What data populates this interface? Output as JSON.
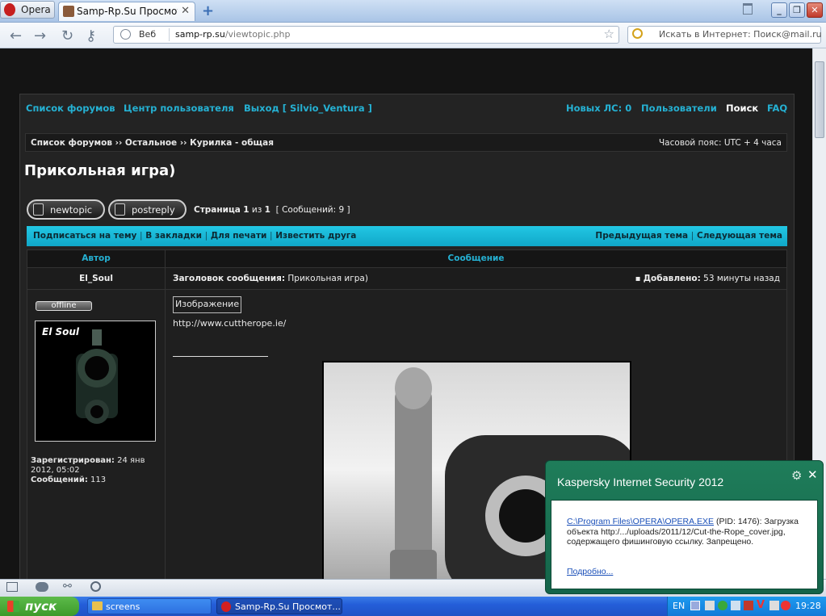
{
  "browser": {
    "menu_label": "Opera",
    "tab_title": "Samp-Rp.Su Просмотр т...",
    "tab_close": "✕",
    "new_tab": "+",
    "address_prefix": "Веб",
    "url_domain": "samp-rp.su",
    "url_path": "/viewtopic.php",
    "search_placeholder": "Искать в Интернет: Поиск@mail.ru"
  },
  "nav": {
    "forum_list": "Список форумов",
    "user_center": "Центр пользователя",
    "logout": "Выход [ Silvio_Ventura ]",
    "new_pm": "Новых ЛС: 0",
    "users": "Пользователи",
    "search": "Поиск",
    "faq": "FAQ"
  },
  "breadcrumb": {
    "path": "Список форумов ›› Остальное ›› Курилка - общая",
    "timezone": "Часовой пояс: UTC + 4 часа"
  },
  "topic": {
    "title": "Прикольная игра)",
    "newtopic_label": "newtopic",
    "postreply_label": "postreply",
    "page_prefix": "Страница",
    "page_current": "1",
    "page_of": "из",
    "page_total": "1",
    "messages": "[ Сообщений: 9 ]"
  },
  "actions": {
    "subscribe": "Подписаться на тему",
    "bookmark": "В закладки",
    "print": "Для печати",
    "notify": "Известить друга",
    "prev_topic": "Предыдущая тема",
    "next_topic": "Следующая тема"
  },
  "table": {
    "col_author": "Автор",
    "col_message": "Сообщение"
  },
  "post": {
    "author": "El_Soul",
    "subject_label": "Заголовок сообщения:",
    "subject": "Прикольная игра)",
    "added_label": "Добавлено:",
    "added": "53 минуты назад",
    "status": "offline",
    "avatar_text": "El Soul",
    "registered_label": "Зарегистрирован:",
    "registered": "24 янв 2012, 05:02",
    "posts_label": "Сообщений:",
    "posts": "113",
    "image_tag": "Изображение",
    "link": "http://www.cuttherope.ie/"
  },
  "taskbar": {
    "start": "пуск",
    "screens": "screens",
    "opera_task": "Samp-Rp.Su Просмот...",
    "lang": "EN",
    "clock": "19:28"
  },
  "kaspersky": {
    "title": "Kaspersky Internet Security 2012",
    "path": "C:\\Program Files\\OPERA\\OPERA.EXE",
    "message": " (PID: 1476): Загрузка объекта http:/.../uploads/2011/12/Cut-the-Rope_cover.jpg, содержащего фишинговую ссылку. Запрещено.",
    "more": "Подробно..."
  },
  "colors": {
    "accent": "#25b1d3",
    "page_bg": "#141414",
    "kaspersky_green": "#1f7d5a"
  }
}
